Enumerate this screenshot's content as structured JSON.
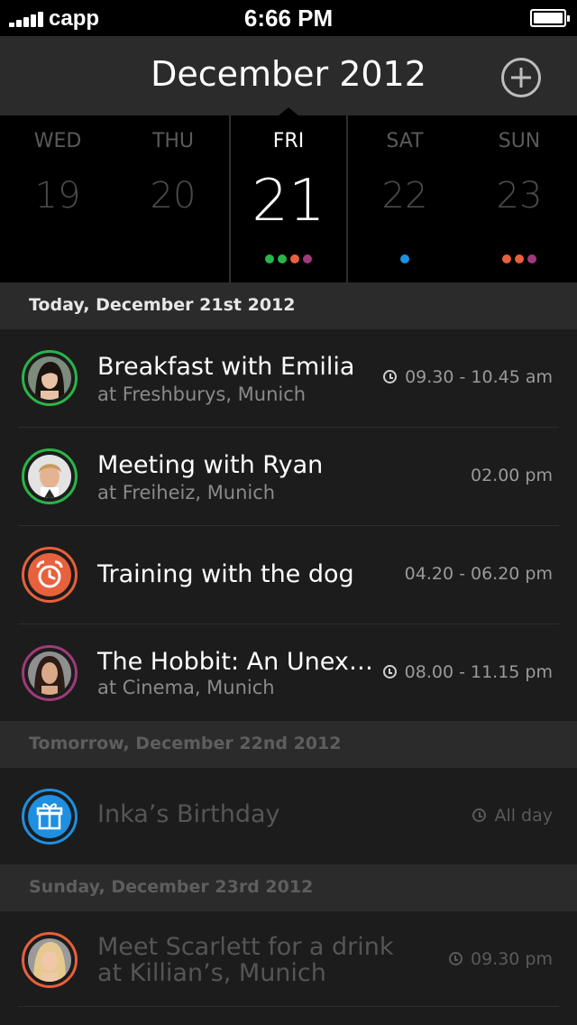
{
  "status_bar": {
    "carrier": "capp",
    "time": "6:66 PM",
    "icons": [
      "signal-icon",
      "battery-icon"
    ]
  },
  "header": {
    "title": "December 2012",
    "add_icon": "plus-circle-icon"
  },
  "week": [
    {
      "name": "WED",
      "number": "19",
      "dots": []
    },
    {
      "name": "THU",
      "number": "20",
      "dots": []
    },
    {
      "name": "FRI",
      "number": "21",
      "selected": true,
      "dots": [
        "#2ab548",
        "#2ab548",
        "#e8603c",
        "#a03a7a"
      ]
    },
    {
      "name": "SAT",
      "number": "22",
      "dots": [
        "#1f8fe0"
      ]
    },
    {
      "name": "SUN",
      "number": "23",
      "dots": [
        "#e8603c",
        "#e8603c",
        "#a03a7a"
      ]
    }
  ],
  "sections": {
    "today": "Today, December 21st 2012",
    "tomorrow": "Tomorrow, December 22nd 2012",
    "sunday": "Sunday, December 23rd 2012"
  },
  "events": [
    {
      "title": "Breakfast with Emilia",
      "location": "at Freshburys, Munich",
      "time": "09.30 - 10.45 am",
      "clock": true,
      "color": "#2ab548",
      "icon": "avatar-emilia"
    },
    {
      "title": "Meeting with Ryan",
      "location": "at Freiheiz, Munich",
      "time": "02.00 pm",
      "clock": false,
      "color": "#2ab548",
      "icon": "avatar-ryan"
    },
    {
      "title": "Training with the dog",
      "location": "",
      "time": "04.20 - 06.20 pm",
      "clock": false,
      "color": "#e8603c",
      "icon": "alarm-clock-icon"
    },
    {
      "title": "The Hobbit: An Unex…",
      "location": "at Cinema, Munich",
      "time": "08.00 - 11.15 pm",
      "clock": true,
      "color": "#a03a7a",
      "icon": "avatar-hobbit"
    },
    {
      "title": "Inka’s Birthday",
      "location": "",
      "time": "All day",
      "clock": true,
      "color": "#1f8fe0",
      "icon": "gift-icon"
    },
    {
      "title": "Meet Scarlett for a drink",
      "location": "at Killian’s, Munich",
      "time": "09.30 pm",
      "clock": true,
      "color": "#e8603c",
      "icon": "avatar-scarlett"
    }
  ],
  "colors": {
    "green": "#2ab548",
    "orange": "#e8603c",
    "purple": "#a03a7a",
    "blue": "#1f8fe0"
  }
}
